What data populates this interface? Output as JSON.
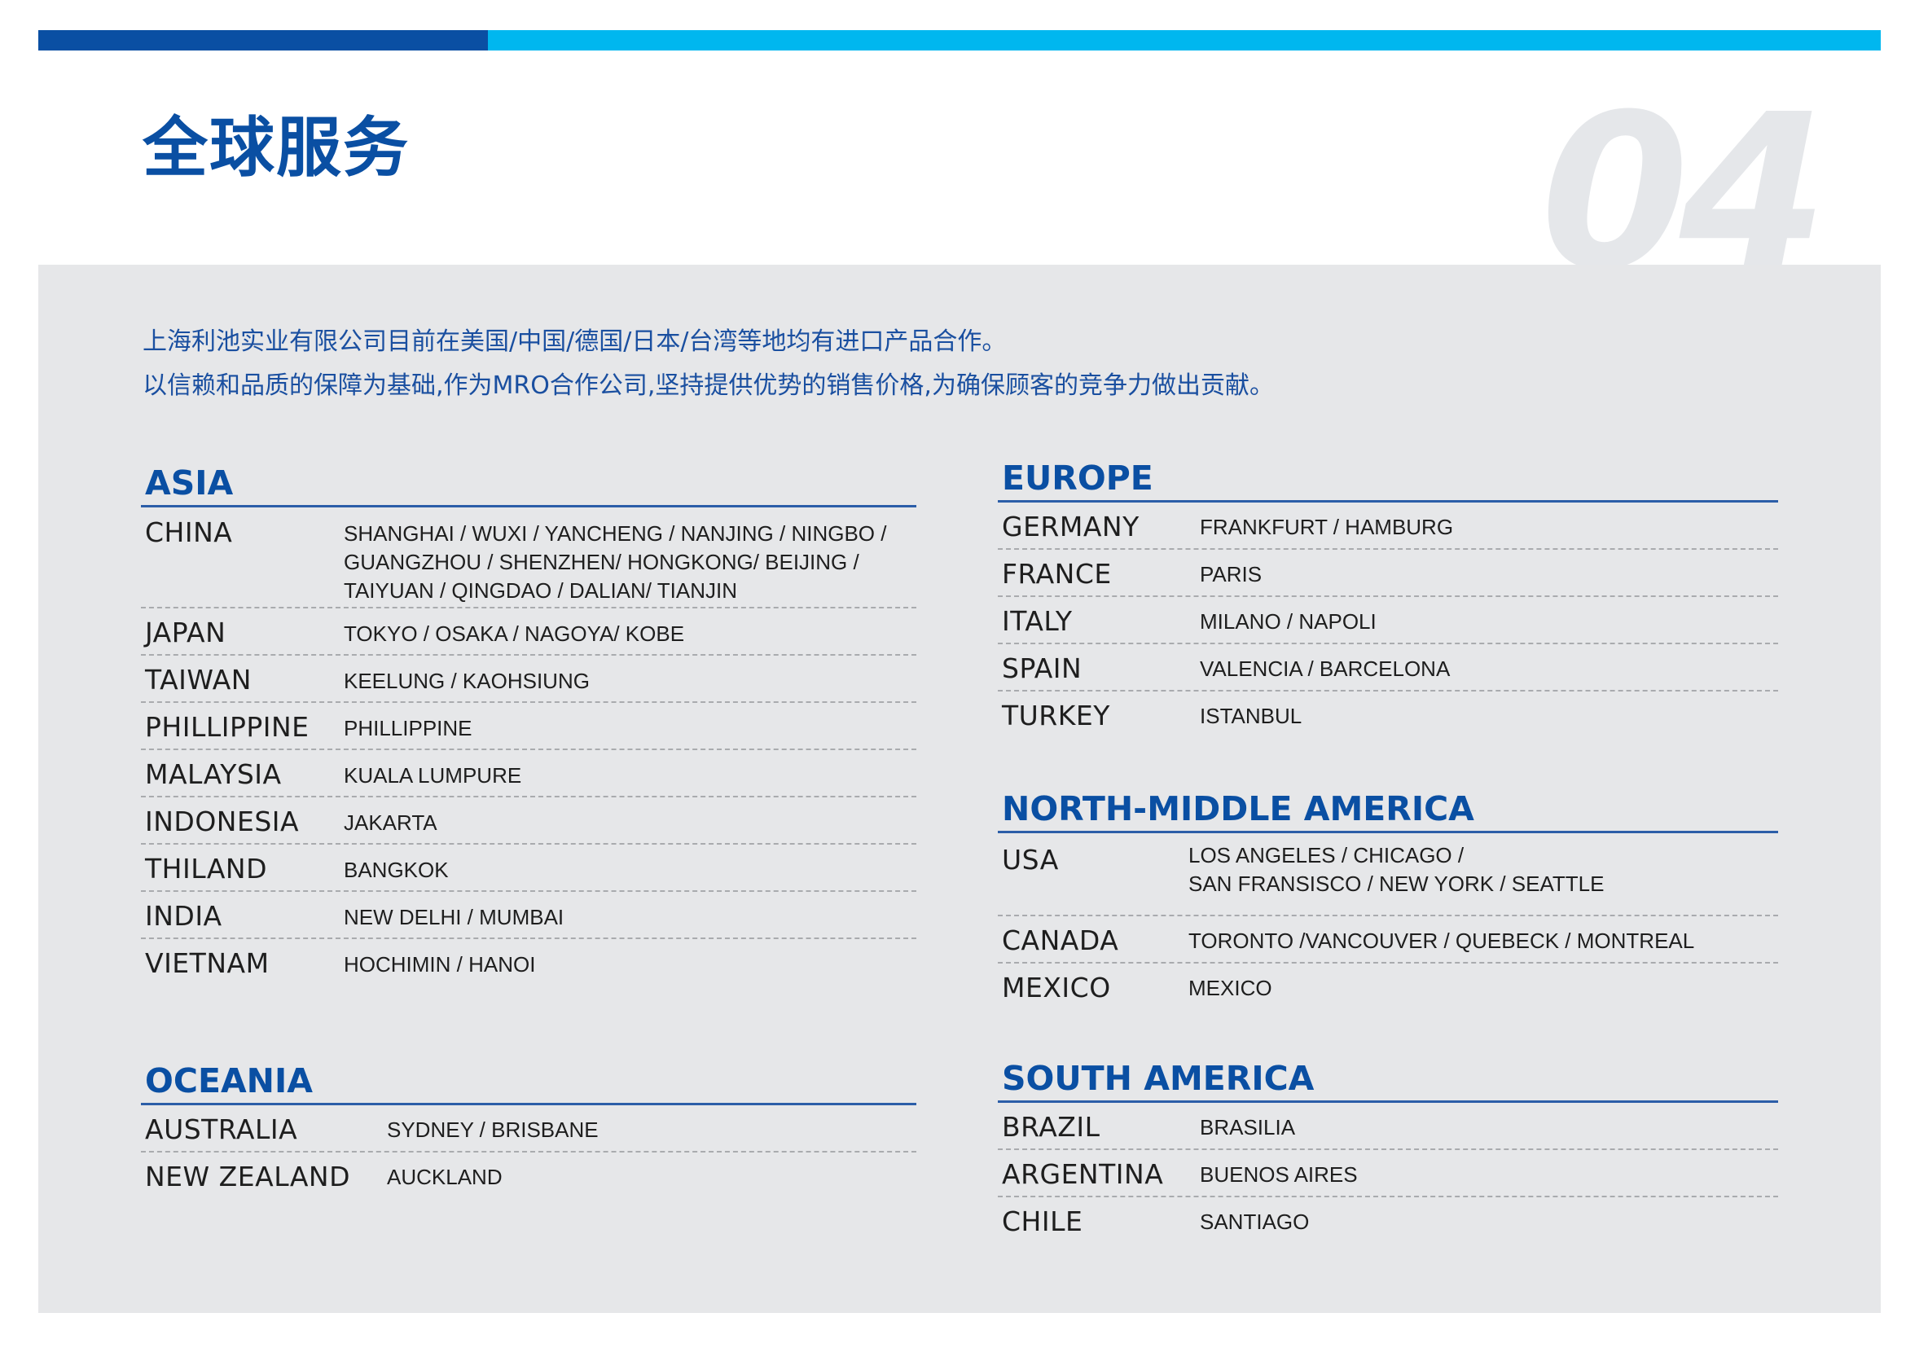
{
  "header": {
    "title": "全球服务",
    "page_number": "04"
  },
  "intro": {
    "line1": "上海利池实业有限公司目前在美国/中国/德国/日本/台湾等地均有进口产品合作。",
    "line2": "以信赖和品质的保障为基础,作为MRO合作公司,坚持提供优势的销售价格,为确保顾客的竞争力做出贡献。"
  },
  "regions": {
    "asia": {
      "title": "ASIA",
      "countries": [
        {
          "name": "CHINA",
          "cities": "SHANGHAI / WUXI / YANCHENG / NANJING / NINGBO /\nGUANGZHOU / SHENZHEN/ HONGKONG/  BEIJING /\nTAIYUAN / QINGDAO / DALIAN/ TIANJIN"
        },
        {
          "name": "JAPAN",
          "cities": "TOKYO / OSAKA / NAGOYA/ KOBE"
        },
        {
          "name": "TAIWAN",
          "cities": "KEELUNG / KAOHSIUNG"
        },
        {
          "name": "PHILLIPPINE",
          "cities": "PHILLIPPINE"
        },
        {
          "name": "MALAYSIA",
          "cities": "KUALA LUMPURE"
        },
        {
          "name": "INDONESIA",
          "cities": "JAKARTA"
        },
        {
          "name": "THILAND",
          "cities": "BANGKOK"
        },
        {
          "name": "INDIA",
          "cities": "NEW DELHI / MUMBAI"
        },
        {
          "name": "VIETNAM",
          "cities": "HOCHIMIN / HANOI"
        }
      ]
    },
    "oceania": {
      "title": "OCEANIA",
      "countries": [
        {
          "name": "AUSTRALIA",
          "cities": "SYDNEY / BRISBANE"
        },
        {
          "name": "NEW ZEALAND",
          "cities": "AUCKLAND"
        }
      ]
    },
    "europe": {
      "title": "EUROPE",
      "countries": [
        {
          "name": "GERMANY",
          "cities": "FRANKFURT / HAMBURG"
        },
        {
          "name": "FRANCE",
          "cities": "PARIS"
        },
        {
          "name": "ITALY",
          "cities": "MILANO / NAPOLI"
        },
        {
          "name": "SPAIN",
          "cities": "VALENCIA / BARCELONA"
        },
        {
          "name": "TURKEY",
          "cities": "ISTANBUL"
        }
      ]
    },
    "north_middle_america": {
      "title": "NORTH-MIDDLE AMERICA",
      "countries": [
        {
          "name": "USA",
          "cities": "LOS ANGELES / CHICAGO /\nSAN FRANSISCO / NEW YORK / SEATTLE"
        },
        {
          "name": "CANADA",
          "cities": "TORONTO /VANCOUVER / QUEBECK / MONTREAL"
        },
        {
          "name": "MEXICO",
          "cities": "MEXICO"
        }
      ]
    },
    "south_america": {
      "title": "SOUTH AMERICA",
      "countries": [
        {
          "name": "BRAZIL",
          "cities": "BRASILIA"
        },
        {
          "name": "ARGENTINA",
          "cities": "BUENOS AIRES"
        },
        {
          "name": "CHILE",
          "cities": "SANTIAGO"
        }
      ]
    }
  },
  "colors": {
    "brand_dark_blue": "#0a4fa3",
    "brand_light_blue": "#00b7ef",
    "panel_gray": "#e6e7e9"
  }
}
